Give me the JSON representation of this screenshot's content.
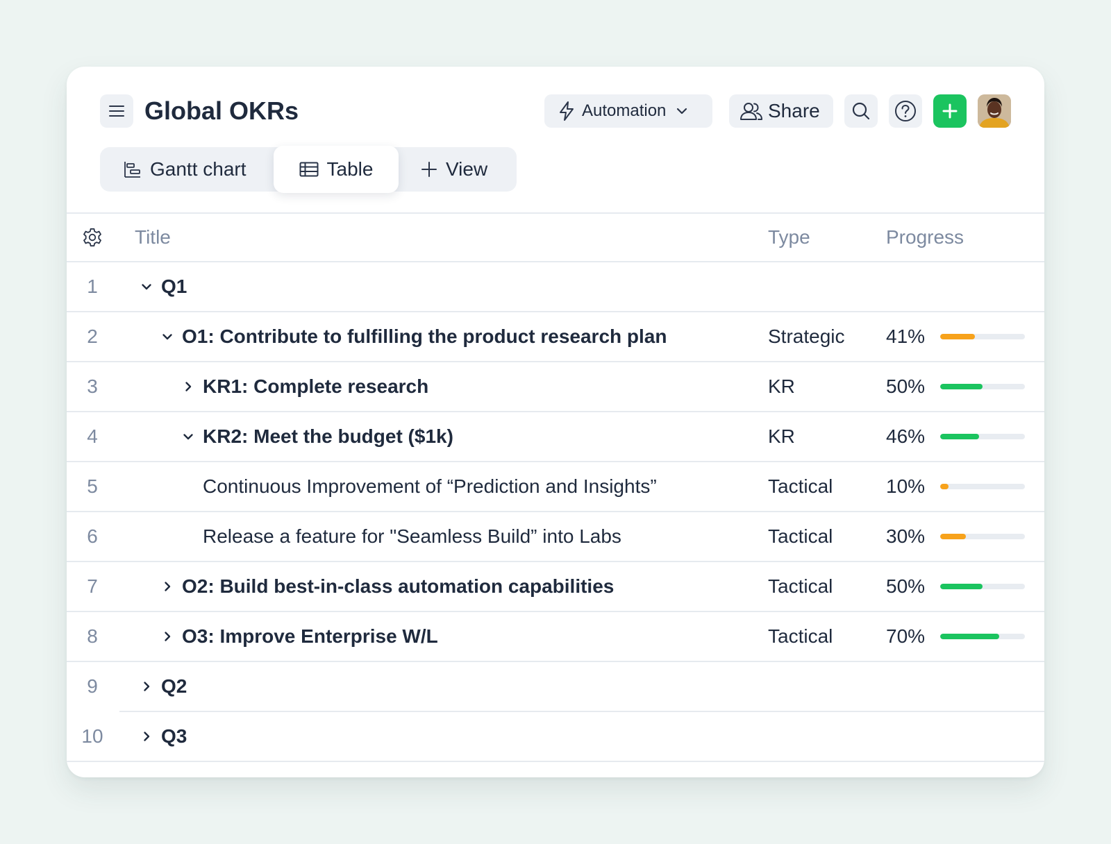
{
  "header": {
    "title": "Global OKRs",
    "automation_label": "Automation",
    "share_label": "Share"
  },
  "tabs": [
    {
      "label": "Gantt chart"
    },
    {
      "label": "Table",
      "active": true
    },
    {
      "label": "View"
    }
  ],
  "columns": {
    "title": "Title",
    "type": "Type",
    "progress": "Progress"
  },
  "colors": {
    "accent_green": "#1bc45f",
    "progress_green": "#1bc45f",
    "progress_orange": "#f7a21b"
  },
  "rows": [
    {
      "num": "1",
      "title": "Q1",
      "type": "",
      "progress": "",
      "progress_value": null,
      "level": 0,
      "chevron": "down",
      "bold": true
    },
    {
      "num": "2",
      "title": "O1: Contribute to fulfilling the product research plan",
      "type": "Strategic",
      "progress": "41%",
      "progress_value": 0.41,
      "level": 1,
      "chevron": "down",
      "bold": true
    },
    {
      "num": "3",
      "title": "KR1: Complete research",
      "type": "KR",
      "progress": "50%",
      "progress_value": 0.5,
      "level": 2,
      "chevron": "right",
      "bold": true
    },
    {
      "num": "4",
      "title": "KR2: Meet the budget ($1k)",
      "type": "KR",
      "progress": "46%",
      "progress_value": 0.46,
      "level": 2,
      "chevron": "down",
      "bold": true
    },
    {
      "num": "5",
      "title": "Continuous Improvement of “Prediction and Insights”",
      "type": "Tactical",
      "progress": "10%",
      "progress_value": 0.1,
      "level": 3,
      "chevron": "none",
      "bold": false
    },
    {
      "num": "6",
      "title": "Release a feature for \"Seamless Build” into Labs",
      "type": "Tactical",
      "progress": "30%",
      "progress_value": 0.3,
      "level": 3,
      "chevron": "none",
      "bold": false
    },
    {
      "num": "7",
      "title": "O2: Build best-in-class automation capabilities",
      "type": "Tactical",
      "progress": "50%",
      "progress_value": 0.5,
      "level": 1,
      "chevron": "right",
      "bold": true
    },
    {
      "num": "8",
      "title": "O3: Improve Enterprise W/L",
      "type": "Tactical",
      "progress": "70%",
      "progress_value": 0.7,
      "level": 1,
      "chevron": "right",
      "bold": true
    },
    {
      "num": "9",
      "title": "Q2",
      "type": "",
      "progress": "",
      "progress_value": null,
      "level": 0,
      "chevron": "right",
      "bold": true
    },
    {
      "num": "10",
      "title": "Q3",
      "type": "",
      "progress": "",
      "progress_value": null,
      "level": 0,
      "chevron": "right",
      "bold": true
    }
  ]
}
